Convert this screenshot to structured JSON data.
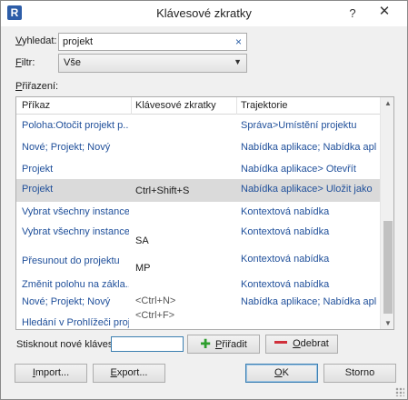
{
  "window": {
    "title": "Klávesové zkratky",
    "help_glyph": "?",
    "close_glyph": "✕",
    "app_icon_letter": "R"
  },
  "search": {
    "label_prefix": "V",
    "label_rest": "yhledat:",
    "value": "projekt",
    "clear_glyph": "×"
  },
  "filter": {
    "label_prefix": "F",
    "label_rest": "iltr:",
    "value": "Vše"
  },
  "assignments_label_prefix": "P",
  "assignments_label_rest": "řiřazení:",
  "columns": {
    "command": "Příkaz",
    "shortcuts": "Klávesové zkratky",
    "path": "Trajektorie"
  },
  "rows": [
    {
      "command": "Poloha:Otočit projekt p...",
      "shortcut": "",
      "path": "Správa>Umístění projektu",
      "selected": false
    },
    {
      "command": "Nové; Projekt; Nový",
      "shortcut": "",
      "path": "Nabídka aplikace; Nabídka aplika...",
      "selected": false
    },
    {
      "command": "Projekt",
      "shortcut": "",
      "path": "Nabídka aplikace> Otevřít",
      "selected": false
    },
    {
      "command": "Projekt",
      "shortcut": "Ctrl+Shift+S",
      "path": "Nabídka aplikace> Uložit jako",
      "selected": true
    },
    {
      "command": "Vybrat všechny instance...",
      "shortcut": "",
      "path": "Kontextová nabídka",
      "selected": false
    },
    {
      "command": "Vybrat všechny instance...",
      "shortcut": "SA",
      "path": "Kontextová nabídka",
      "selected": false
    },
    {
      "command": "Přesunout do projektu",
      "shortcut": "MP",
      "path": "Kontextová nabídka",
      "selected": false
    },
    {
      "command": "Změnit polohu na zákla...",
      "shortcut": "",
      "path": "Kontextová nabídka",
      "selected": false
    },
    {
      "command": "Nové; Projekt; Nový",
      "shortcut": "<Ctrl+N>",
      "path": "Nabídka aplikace; Nabídka aplika...",
      "selected": false
    },
    {
      "command": "Hledání v Prohlížeči proj...",
      "shortcut": "<Ctrl+F>",
      "path": "",
      "selected": false
    }
  ],
  "press_keys": {
    "label": "Stisknout nové klávesy:",
    "value": ""
  },
  "buttons": {
    "assign_prefix": "P",
    "assign_rest": "řiřadit",
    "remove_prefix": "O",
    "remove_rest": "debrat",
    "import_prefix": "I",
    "import_rest": "mport...",
    "export_prefix": "E",
    "export_rest": "xport...",
    "ok_prefix": "O",
    "ok_rest": "K",
    "cancel": "Storno"
  },
  "colors": {
    "accent": "#3c7fb1",
    "selected_row": "#dadada",
    "shortcut_gray": "#555555",
    "add_green": "#2e9e2e",
    "remove_red": "#d0303b"
  }
}
